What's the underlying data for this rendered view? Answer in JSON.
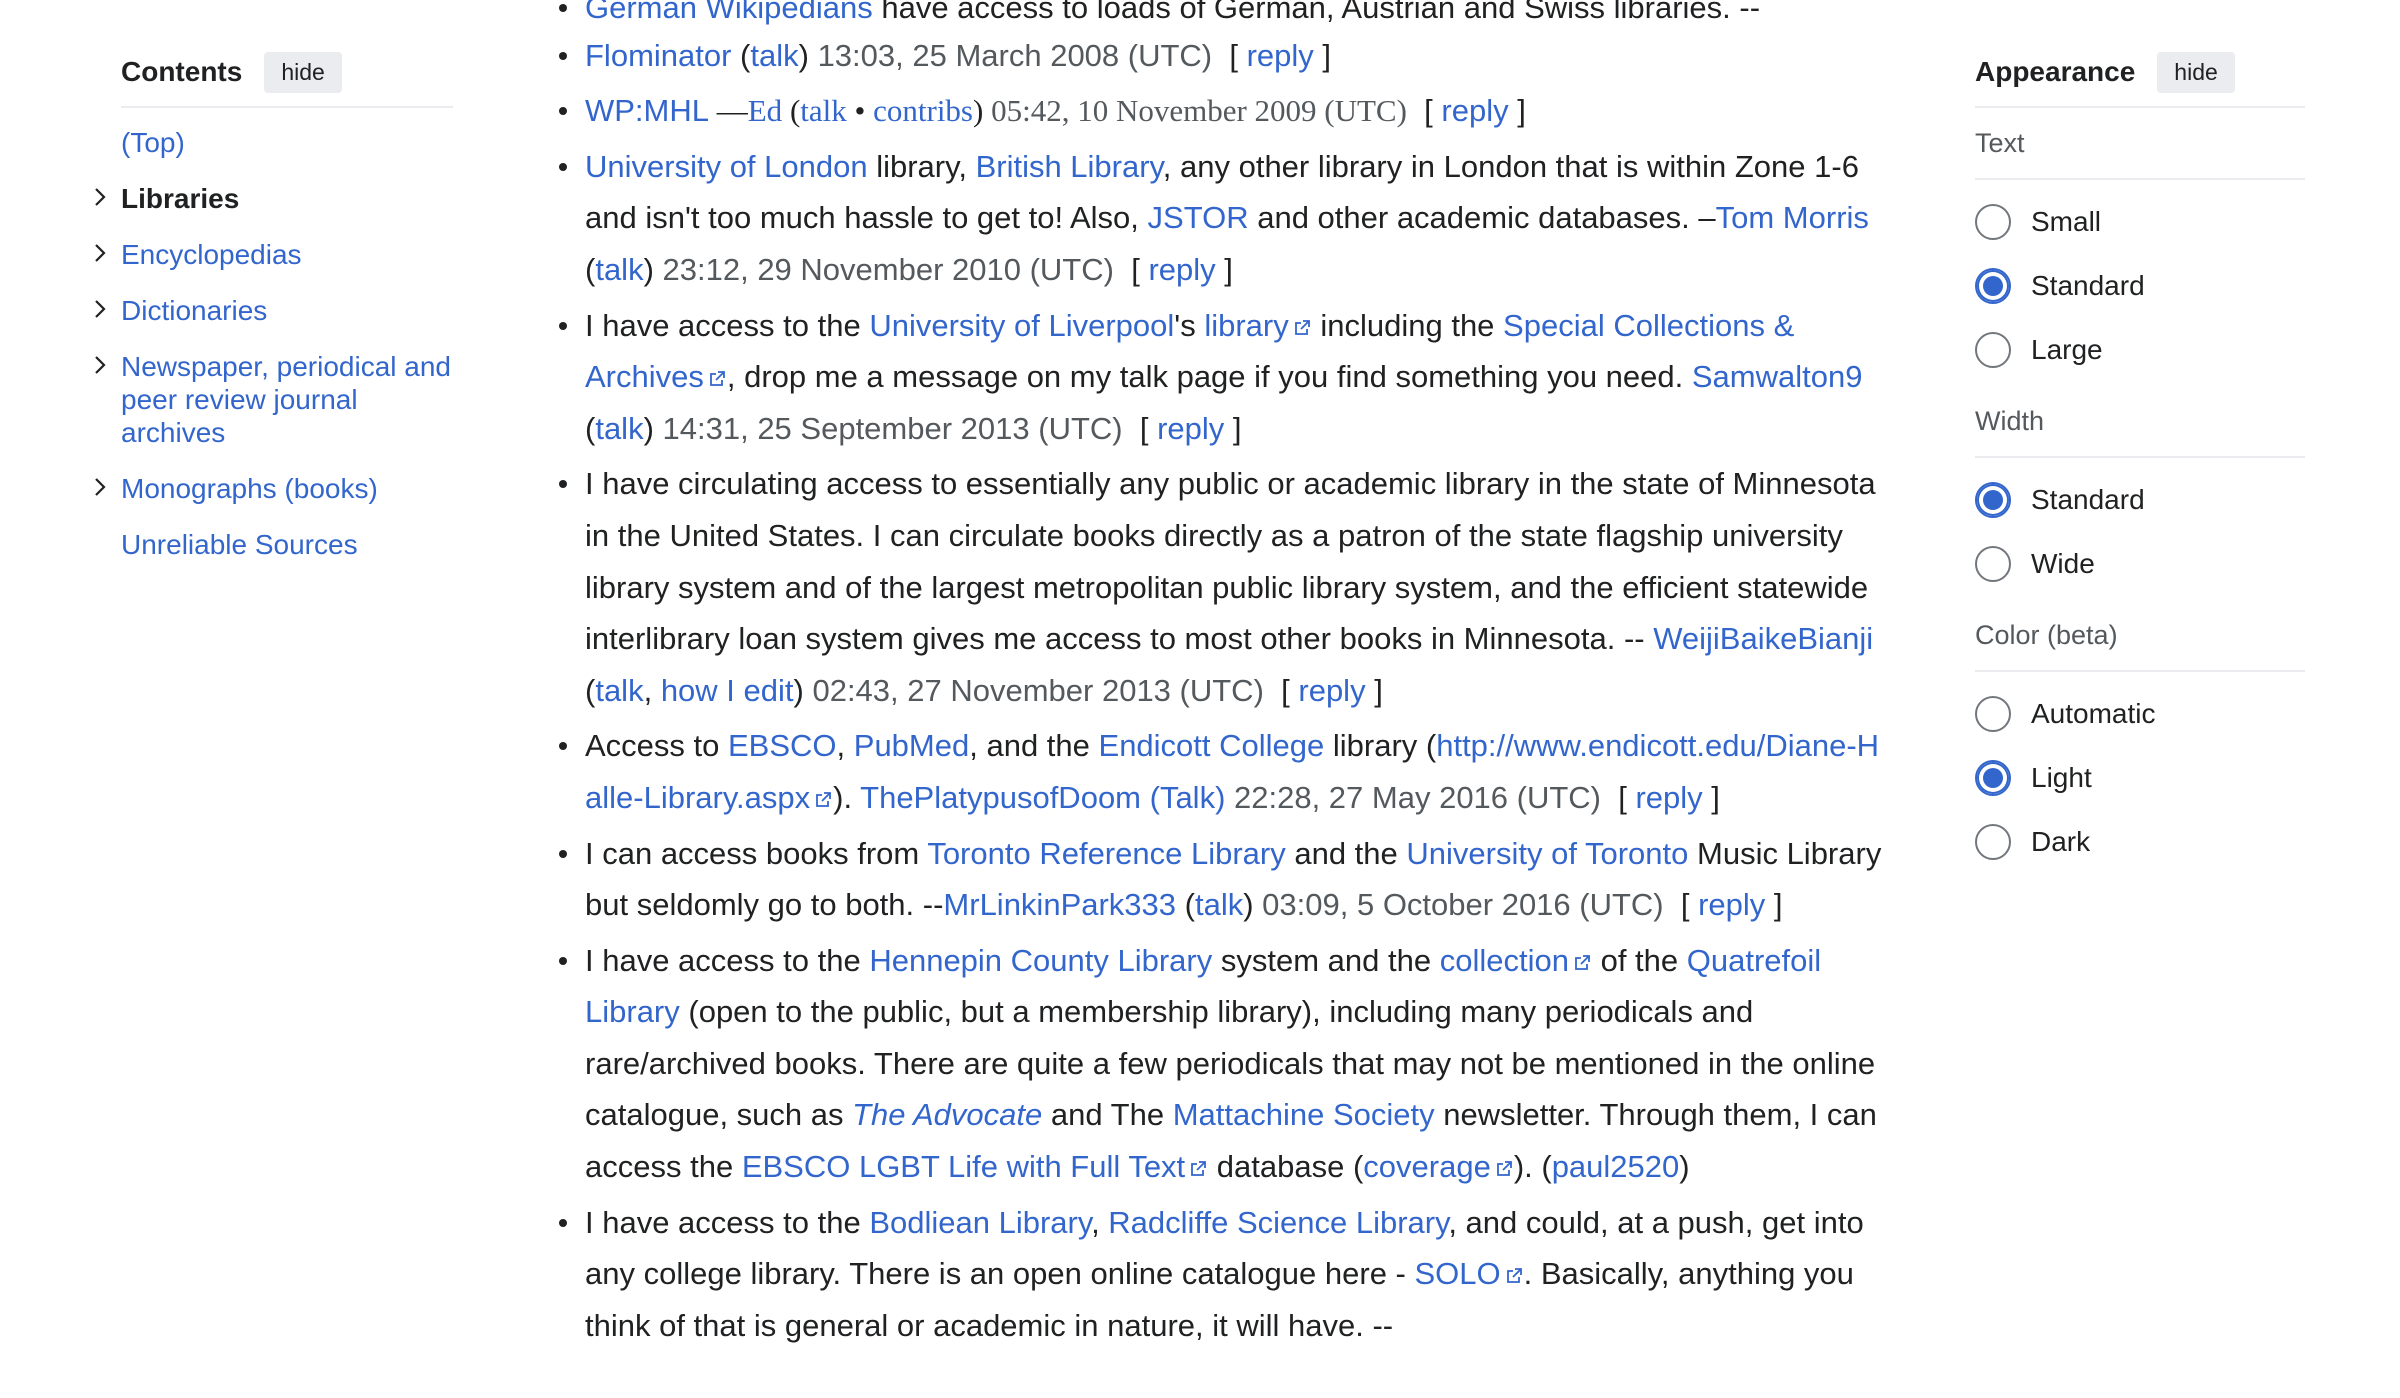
{
  "toc": {
    "title": "Contents",
    "hide_label": "hide",
    "items": [
      {
        "label": "(Top)"
      },
      {
        "label": "Libraries"
      },
      {
        "label": "Encyclopedias"
      },
      {
        "label": "Dictionaries"
      },
      {
        "label": "Newspaper, periodical and peer review journal archives"
      },
      {
        "label": "Monographs (books)"
      },
      {
        "label": "Unreliable Sources"
      }
    ]
  },
  "appearance": {
    "title": "Appearance",
    "hide_label": "hide",
    "text_group": "Text",
    "text_options": [
      "Small",
      "Standard",
      "Large"
    ],
    "text_selected": "Standard",
    "width_group": "Width",
    "width_options": [
      "Standard",
      "Wide"
    ],
    "width_selected": "Standard",
    "color_group": "Color (beta)",
    "color_options": [
      "Automatic",
      "Light",
      "Dark"
    ],
    "color_selected": "Light"
  },
  "entries": {
    "e0": {
      "user": "German Wikipedians",
      "text": " have access to loads of German, Austrian and Swiss libraries. --"
    },
    "e1": {
      "user": "Flominator",
      "talk": "talk",
      "ts": " 13:03, 25 March 2008 (UTC)",
      "reply": "reply"
    },
    "e2": {
      "user": "WP:MHL",
      "dash": " —",
      "sig_user": "Ed",
      "talk": "talk",
      "bullet": " • ",
      "contribs": "contribs",
      "ts": " 05:42, 10 November 2009 (UTC)",
      "reply": "reply"
    },
    "e3": {
      "l1": "University of London",
      "t1": " library, ",
      "l2": "British Library",
      "t2": ", any other library in London that is within Zone 1-6 and isn't too much hassle to get to! Also, ",
      "l3": "JSTOR",
      "t3": " and other academic databases. –",
      "user": "Tom Morris",
      "talk": "talk",
      "ts": " 23:12, 29 November 2010 (UTC)",
      "reply": "reply"
    },
    "e4": {
      "t0": "I have access to the ",
      "l1": "University of Liverpool",
      "t1": "'s ",
      "l2": "library",
      "t2": " including the ",
      "l3": "Special Collections & Archives",
      "t3": ", drop me a message on my talk page if you find something you need. ",
      "user": "Samwalton9",
      "talk": "talk",
      "ts": " 14:31, 25 September 2013 (UTC)",
      "reply": "reply"
    },
    "e5": {
      "t0": "I have circulating access to essentially any public or academic library in the state of Minnesota in the United States. I can circulate books directly as a patron of the state flagship university library system and of the largest metropolitan public library system, and the efficient statewide interlibrary loan system gives me access to most other books in Minnesota. -- ",
      "user": "WeijiBaikeBianji",
      "talk": "talk",
      "howiedit": "how I edit",
      "ts": " 02:43, 27 November 2013 (UTC)",
      "reply": "reply"
    },
    "e6": {
      "t0": "Access to ",
      "l1": "EBSCO",
      "t1": ", ",
      "l2": "PubMed",
      "t2": ", and the ",
      "l3": "Endicott College",
      "t3": " library (",
      "url": "http://www.endicott.edu/Diane-Halle-Library.aspx",
      "t4": "). ",
      "user": "ThePlatypusofDoom (Talk)",
      "ts": " 22:28, 27 May 2016 (UTC)",
      "reply": "reply"
    },
    "e7": {
      "t0": "I can access books from ",
      "l1": "Toronto Reference Library",
      "t1": " and the ",
      "l2": "University of Toronto",
      "t2": " Music Library but seldomly go to both. --",
      "user": "MrLinkinPark333",
      "talk": "talk",
      "ts": " 03:09, 5 October 2016 (UTC)",
      "reply": "reply"
    },
    "e8": {
      "t0": "I have access to the ",
      "l1": "Hennepin County Library",
      "t1": " system and the ",
      "l2": "collection",
      "t2": " of the ",
      "l3": "Quatrefoil Library",
      "t3": " (open to the public, but a membership library), including many periodicals and rare/archived books. There are quite a few periodicals that may not be mentioned in the online catalogue, such as ",
      "l4": "The Advocate",
      "t4": " and The ",
      "l5": "Mattachine Society",
      "t5": " newsletter. Through them, I can access the ",
      "l6": "EBSCO LGBT Life with Full Text",
      "t6": " database (",
      "l7": "coverage",
      "t7": "). (",
      "user": "paul2520",
      "t8": ")"
    },
    "e9": {
      "t0": "I have access to the ",
      "l1": "Bodliean Library",
      "t1": ", ",
      "l2": "Radcliffe Science Library",
      "t2": ", and could, at a push, get into any college library. There is an open online catalogue here - ",
      "l3": "SOLO",
      "t3": ". Basically, anything you think of that is general or academic in nature, it will have. --"
    }
  }
}
